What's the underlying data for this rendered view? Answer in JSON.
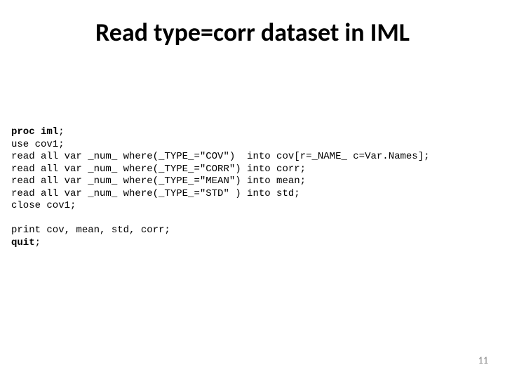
{
  "title": "Read type=corr dataset in IML",
  "code": {
    "l1a": "proc iml",
    "l1b": ";",
    "l2": "use cov1;",
    "l3": "read all var _num_ where(_TYPE_=\"COV\")  into cov[r=_NAME_ c=Var.Names];",
    "l4": "read all var _num_ where(_TYPE_=\"CORR\") into corr;",
    "l5": "read all var _num_ where(_TYPE_=\"MEAN\") into mean;",
    "l6": "read all var _num_ where(_TYPE_=\"STD\" ) into std;",
    "l7": "close cov1;",
    "l8": "",
    "l9": "print cov, mean, std, corr;",
    "l10a": "quit",
    "l10b": ";"
  },
  "page_number": "11"
}
